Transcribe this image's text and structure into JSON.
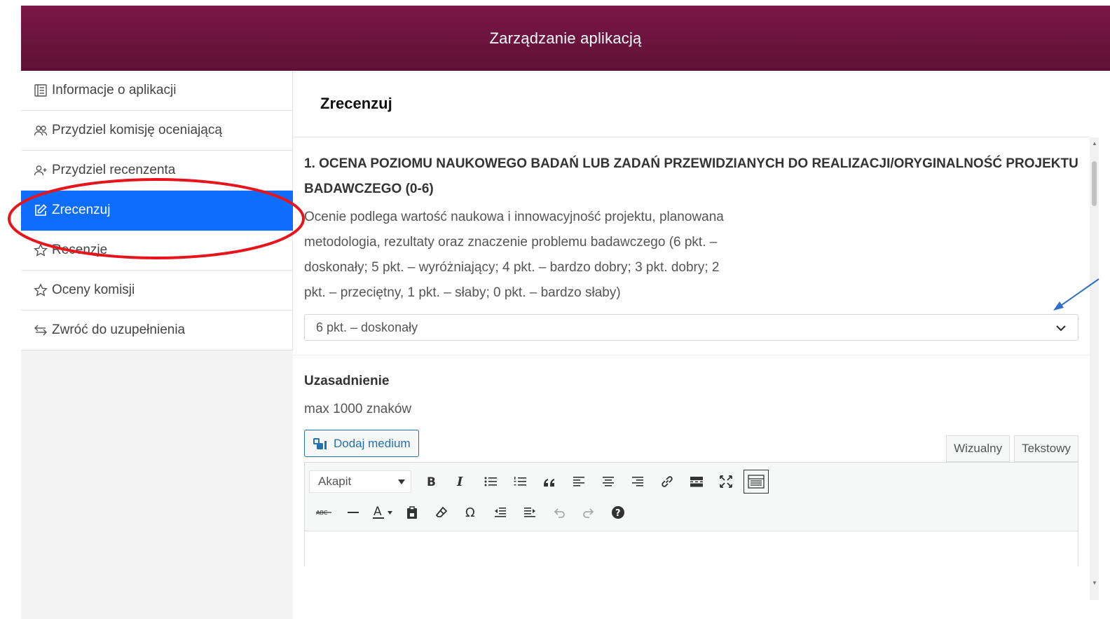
{
  "header": {
    "title": "Zarządzanie aplikacją"
  },
  "sidebar": {
    "items": [
      {
        "label": "Informacje o aplikacji",
        "icon": "document-list-icon",
        "active": false
      },
      {
        "label": "Przydziel komisję oceniającą",
        "icon": "people-icon",
        "active": false
      },
      {
        "label": "Przydziel recenzenta",
        "icon": "person-add-icon",
        "active": false
      },
      {
        "label": "Zrecenzuj",
        "icon": "edit-icon",
        "active": true
      },
      {
        "label": "Recenzje",
        "icon": "star-icon",
        "active": false
      },
      {
        "label": "Oceny komisji",
        "icon": "star-icon",
        "active": false
      },
      {
        "label": "Zwróć do uzupełnienia",
        "icon": "swap-arrows-icon",
        "active": false
      }
    ]
  },
  "main": {
    "title": "Zrecenzuj",
    "question": {
      "title": "1. OCENA POZIOMU NAUKOWEGO BADAŃ LUB ZADAŃ PRZEWIDZIANYCH DO REALIZACJI/ORYGINALNOŚĆ PROJEKTU BADAWCZEGO (0-6)",
      "description": "Ocenie podlega wartość naukowa i innowacyjność projektu, planowana metodologia, rezultaty oraz znaczenie problemu badawczego (6 pkt. – doskonały; 5 pkt. – wyróżniający; 4 pkt. – bardzo dobry; 3 pkt. dobry; 2 pkt. – przeciętny, 1 pkt. – słaby; 0 pkt. – bardzo słaby)",
      "selected_value": "6 pkt. – doskonały"
    },
    "justification": {
      "label": "Uzasadnienie",
      "hint": "max 1000 znaków",
      "add_media_label": "Dodaj medium",
      "tabs": [
        "Wizualny",
        "Tekstowy"
      ],
      "format_select": "Akapit"
    }
  },
  "annotations": {
    "highlight_color": "#e8141c",
    "arrow_color": "#2f6fc8"
  }
}
